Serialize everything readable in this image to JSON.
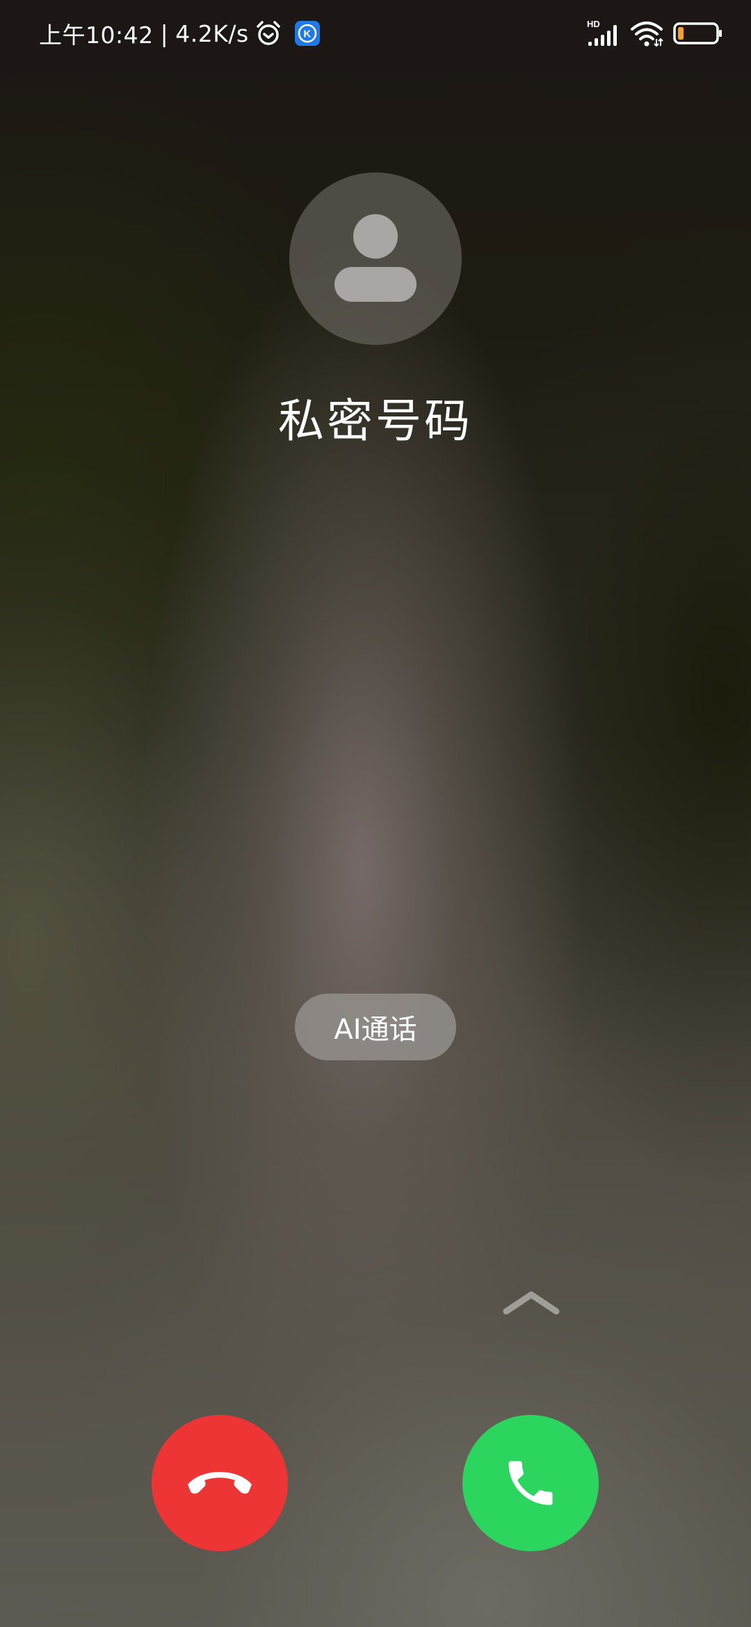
{
  "status_bar": {
    "time": "上午10:42",
    "separator": "|",
    "net_speed": "4.2K/s",
    "network_badge": "HD",
    "alarm_icon": "alarm-clock-icon",
    "app_icon": "k-app-icon",
    "app_letter": "K",
    "signal_icon": "cellular-signal-icon",
    "wifi_icon": "wifi-icon",
    "battery_icon": "battery-icon",
    "battery_level": 0.15,
    "battery_color": "#f0a030"
  },
  "caller": {
    "avatar_icon": "person-placeholder-icon",
    "name": "私密号码"
  },
  "ai_call": {
    "label": "AI通话"
  },
  "swipe_hint": {
    "icon": "chevron-up-icon"
  },
  "actions": {
    "decline_icon": "hang-up-icon",
    "decline_color": "#ee3535",
    "answer_icon": "phone-icon",
    "answer_color": "#2bd55e"
  }
}
